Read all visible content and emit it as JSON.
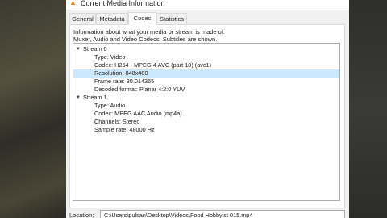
{
  "window": {
    "title": "Current Media Information"
  },
  "tabs": [
    {
      "label": "General"
    },
    {
      "label": "Metadata"
    },
    {
      "label": "Codec"
    },
    {
      "label": "Statistics"
    }
  ],
  "codec": {
    "info_line1": "Information about what your media or stream is made of.",
    "info_line2": "Muxer, Audio and Video Codecs, Subtitles are shown.",
    "streams": [
      {
        "label": "Stream 0",
        "items": [
          "Type: Video",
          "Codec: H264 - MPEG-4 AVC (part 10) (avc1)",
          "Resolution: 848x480",
          "Frame rate: 30.014365",
          "Decoded format: Planar 4:2:0 YUV"
        ]
      },
      {
        "label": "Stream 1",
        "items": [
          "Type: Audio",
          "Codec: MPEG AAC Audio (mp4a)",
          "Channels: Stereo",
          "Sample rate: 48000 Hz"
        ]
      }
    ]
  },
  "location": {
    "label": "Location:",
    "value": "C:\\Users\\pulsan\\Desktop\\Videos\\Food Hobbyist 015.mp4"
  },
  "colors": {
    "selection": "#cce8ff",
    "window_bg": "#f0f0f0",
    "title_icon": "#e67e22"
  }
}
